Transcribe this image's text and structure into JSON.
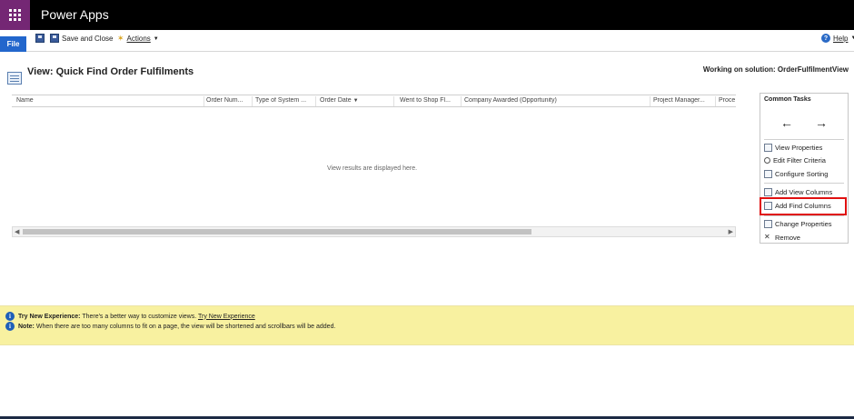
{
  "app": {
    "title": "Power Apps"
  },
  "ribbon": {
    "file_label": "File",
    "save_close_label": "Save and Close",
    "actions_label": "Actions",
    "help_label": "Help"
  },
  "header": {
    "title": "View: Quick Find Order Fulfilments",
    "solution": "Working on solution: OrderFulfilmentView"
  },
  "grid": {
    "columns": [
      "Name",
      "Order Num...",
      "Type of System ...",
      "Order Date",
      "Went to Shop Fl...",
      "Company Awarded (Opportunity)",
      "Project Manager...",
      "Proce"
    ],
    "empty_message": "View results are displayed here."
  },
  "tasks": {
    "title": "Common Tasks",
    "back_arrow": "←",
    "forward_arrow": "→",
    "items": [
      "View Properties",
      "Edit Filter Criteria",
      "Configure Sorting",
      "Add View Columns",
      "Add Find Columns",
      "Change Properties",
      "Remove"
    ]
  },
  "notice": {
    "try_label": "Try New Experience:",
    "try_text": "There's a better way to customize views.",
    "try_link": "Try New Experience",
    "note_label": "Note:",
    "note_text": "When there are too many columns to fit on a page, the view will be shortened and scrollbars will be added."
  },
  "colors": {
    "waffle": "#742774",
    "file_tab": "#2266cc",
    "notice_bg": "#f8f1a0",
    "highlight": "#e01010"
  }
}
